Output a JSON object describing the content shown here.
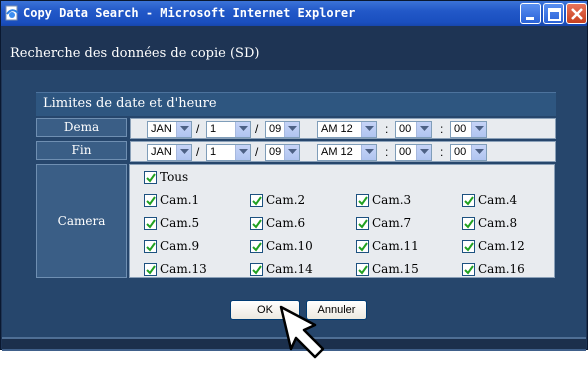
{
  "window": {
    "title": "Copy Data Search - Microsoft Internet Explorer",
    "minimize_icon": "minimize-icon",
    "maximize_icon": "maximize-icon",
    "close_icon": "close-icon"
  },
  "page": {
    "heading": "Recherche des données de copie (SD)"
  },
  "panel": {
    "title": "Limites de date et d'heure"
  },
  "start": {
    "label": "Dema",
    "month": "JAN",
    "day": "1",
    "year": "09",
    "hour": "AM 12",
    "minute": "00",
    "second": "00"
  },
  "end": {
    "label": "Fin",
    "month": "JAN",
    "day": "1",
    "year": "09",
    "hour": "AM 12",
    "minute": "00",
    "second": "00"
  },
  "separators": {
    "date": "/",
    "time": ":"
  },
  "camera": {
    "label": "Camera",
    "all_label": "Tous",
    "all_checked": true,
    "cams": [
      "Cam.1",
      "Cam.2",
      "Cam.3",
      "Cam.4",
      "Cam.5",
      "Cam.6",
      "Cam.7",
      "Cam.8",
      "Cam.9",
      "Cam.10",
      "Cam.11",
      "Cam.12",
      "Cam.13",
      "Cam.14",
      "Cam.15",
      "Cam.16"
    ]
  },
  "buttons": {
    "ok": "OK",
    "cancel": "Annuler"
  },
  "colors": {
    "titlebar": "#2258c8",
    "window_bg": "#1e3454",
    "form_bg": "#26466c",
    "field_bg": "#e8ebef",
    "checkbox_mark": "#21a121"
  }
}
